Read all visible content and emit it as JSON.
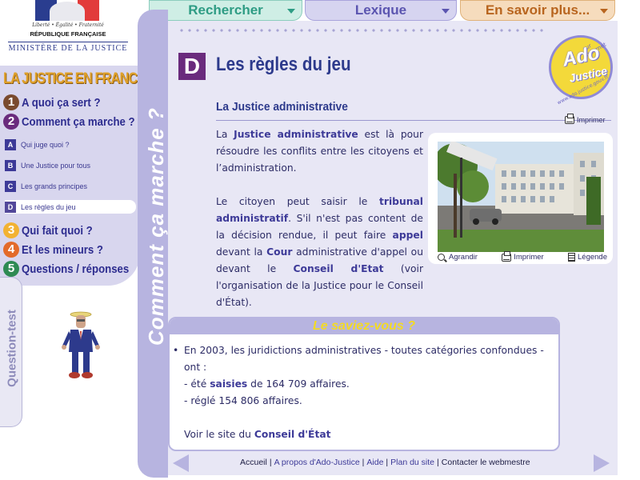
{
  "tabs": {
    "rechercher": "Rechercher",
    "lexique": "Lexique",
    "en_savoir_plus": "En savoir plus..."
  },
  "logo": {
    "motto": "Liberté • Égalité • Fraternité",
    "republique": "RÉPUBLIQUE FRANÇAISE",
    "ministere": "MINISTÈRE DE LA JUSTICE"
  },
  "sidebar": {
    "heading": "LA JUSTICE EN FRANCE :",
    "main_items": [
      {
        "num": "1",
        "label": "A quoi ça sert ?",
        "color": "#7a4a2e"
      },
      {
        "num": "2",
        "label": "Comment ça marche ?",
        "color": "#6a2b7d"
      },
      {
        "num": "3",
        "label": "Qui fait quoi ?",
        "color": "#f2b233"
      },
      {
        "num": "4",
        "label": "Et les mineurs ?",
        "color": "#e36a2a"
      },
      {
        "num": "5",
        "label": "Questions / réponses",
        "color": "#2e8a53"
      }
    ],
    "sub_items": [
      {
        "letter": "A",
        "label": "Qui juge quoi ?"
      },
      {
        "letter": "B",
        "label": "Une Justice pour tous"
      },
      {
        "letter": "C",
        "label": "Les grands principes"
      },
      {
        "letter": "D",
        "label": "Les règles du jeu"
      }
    ],
    "question_test": "Question-test"
  },
  "vertical_band": "Comment ça marche ?",
  "badge": {
    "ado": "Ado",
    "justice": "Justice",
    "sur_internet": "sur internet",
    "url": "www.ado.justice.gouv.fr"
  },
  "page": {
    "letter": "D",
    "title": "Les règles du jeu",
    "subtitle": "La Justice administrative",
    "print_label": "Imprimer"
  },
  "body": {
    "p1_a": "La ",
    "p1_b": "Justice administrative",
    "p1_c": " est là pour résoudre les conflits entre les citoyens et l’administration.",
    "p2_a": "Le citoyen peut saisir le ",
    "p2_b": "tribunal administratif",
    "p2_c": ". S'il n'est pas content de la décision rendue, il peut faire ",
    "p2_d": "appel",
    "p2_e": " devant la ",
    "p2_f": "Cour",
    "p2_g": " administrative d'appel ou devant le ",
    "p2_h": "Conseil d'Etat",
    "p2_i": " (voir l'organisation de la Justice pour le Conseil d'État)."
  },
  "photo": {
    "agrandir": "Agrandir",
    "imprimer": "Imprimer",
    "legende": "Légende"
  },
  "saviez": {
    "heading": "Le saviez-vous ?",
    "line1": "En 2003, les juridictions administratives - toutes catégories confondues - ont :",
    "line2_a": "- été ",
    "line2_b": "saisies",
    "line2_c": " de 164 709 affaires.",
    "line3": "- réglé 154 806 affaires.",
    "line4_a": "Voir le site du ",
    "line4_b": "Conseil d'État"
  },
  "footer": {
    "accueil": "Accueil",
    "apropos": "A propos d'Ado-Justice",
    "aide": "Aide",
    "plan": "Plan du site",
    "contact": "Contacter le webmestre",
    "sep": "|"
  }
}
